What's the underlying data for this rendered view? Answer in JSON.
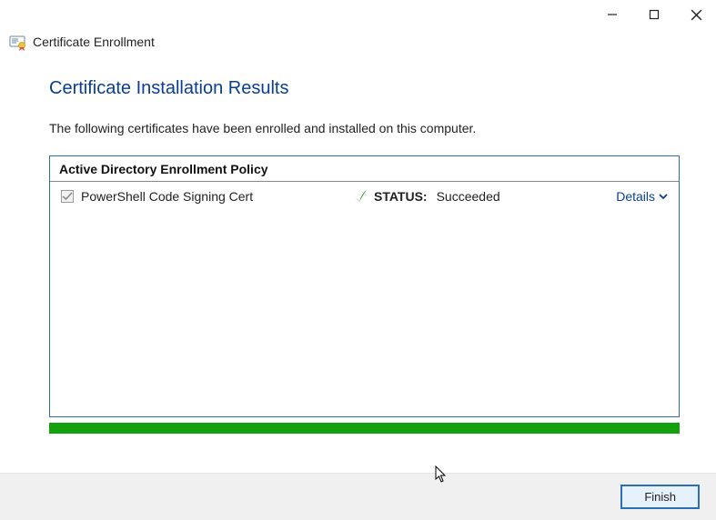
{
  "window": {
    "title": "Certificate Enrollment"
  },
  "page": {
    "heading": "Certificate Installation Results",
    "description": "The following certificates have been enrolled and installed on this computer."
  },
  "policy": {
    "header": "Active Directory Enrollment Policy",
    "rows": [
      {
        "name": "PowerShell Code Signing Cert",
        "status_label": "STATUS:",
        "status_value": "Succeeded",
        "details_label": "Details"
      }
    ]
  },
  "footer": {
    "finish": "Finish"
  }
}
